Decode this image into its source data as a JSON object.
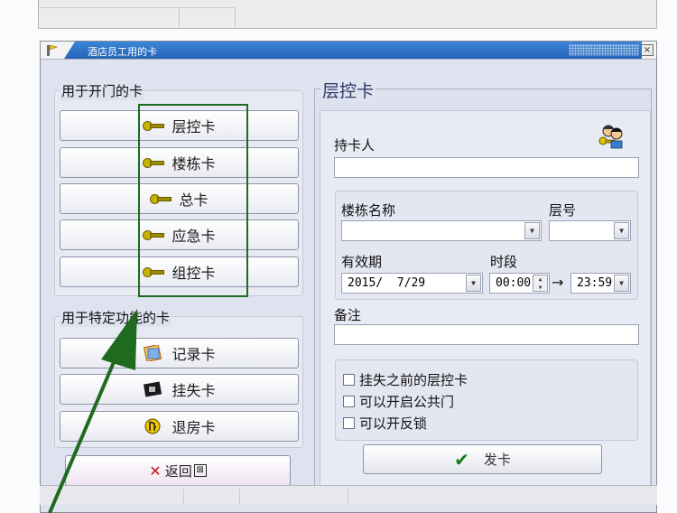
{
  "dialog": {
    "title": "酒店员工用的卡",
    "close_label": "×"
  },
  "open_door_group": {
    "title": "用于开门的卡",
    "buttons": [
      {
        "label": "层控卡",
        "icon": "key-icon"
      },
      {
        "label": "楼栋卡",
        "icon": "key-icon"
      },
      {
        "label": "总卡",
        "icon": "key-icon"
      },
      {
        "label": "应急卡",
        "icon": "key-icon"
      },
      {
        "label": "组控卡",
        "icon": "key-icon"
      }
    ]
  },
  "special_group": {
    "title": "用于特定功能的卡",
    "buttons": [
      {
        "label": "记录卡",
        "icon": "record-card-icon"
      },
      {
        "label": "挂失卡",
        "icon": "chip-card-icon"
      },
      {
        "label": "退房卡",
        "icon": "checkout-icon"
      }
    ]
  },
  "return_button": {
    "label": "返回",
    "icon": "x-icon"
  },
  "form": {
    "title": "层控卡",
    "holder_label": "持卡人",
    "holder_value": "",
    "building_label": "楼栋名称",
    "building_value": "",
    "floor_label": "层号",
    "floor_value": "",
    "validity_label": "有效期",
    "validity_value": "2015/  7/29",
    "timespan_label": "时段",
    "time_start": "00:00",
    "arrow": "→",
    "time_end": "23:59",
    "notes_label": "备注",
    "notes_value": "",
    "options": [
      {
        "label": "挂失之前的层控卡",
        "checked": false
      },
      {
        "label": "可以开启公共门",
        "checked": false
      },
      {
        "label": "可以开反锁",
        "checked": false
      }
    ],
    "issue_button": "发卡"
  },
  "colors": {
    "title_bar": "#2563b8",
    "dialog_bg": "#dfe2ef",
    "annotation": "#1e6a1e"
  }
}
